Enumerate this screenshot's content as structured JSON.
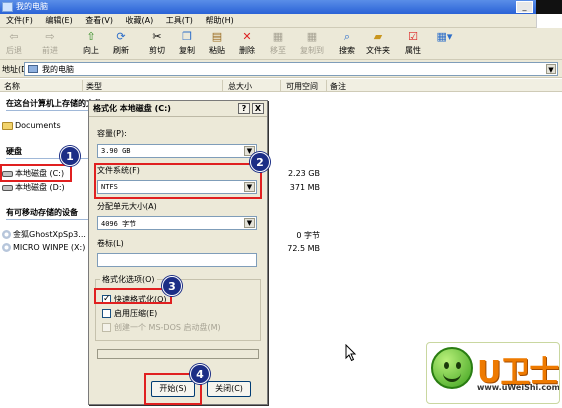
{
  "window": {
    "title": "我的电脑"
  },
  "menu": [
    "文件(F)",
    "编辑(E)",
    "查看(V)",
    "收藏(A)",
    "工具(T)",
    "帮助(H)"
  ],
  "toolbar": {
    "back": "后退",
    "forward": "前进",
    "up": "向上",
    "refresh": "刷新",
    "cut": "剪切",
    "copy": "复制",
    "paste": "粘贴",
    "delete": "删除",
    "move_to": "移至",
    "copy_to": "复制到",
    "search": "搜索",
    "folders": "文件夹",
    "properties": "属性"
  },
  "address": {
    "label": "地址(D)",
    "value": "我的电脑"
  },
  "columns": [
    "名称",
    "类型",
    "总大小",
    "可用空间",
    "备注"
  ],
  "groups": {
    "stored": "在这台计算机上存储的文件",
    "hdd": "硬盘",
    "removable": "有可移动存储的设备"
  },
  "items": {
    "documents": "Documents",
    "drive_c": "本地磁盘 (C:)",
    "drive_d": "本地磁盘 (D:)",
    "cd1": "金狐GhostXpSp3...",
    "cd2": "MICRO WINPE (X:)"
  },
  "sizes": {
    "c_free": "2.23 GB",
    "d_free": "371 MB",
    "cd1_free": "0 字节",
    "cd2_free": "72.5 MB"
  },
  "dialog": {
    "title": "格式化 本地磁盘 (C:)",
    "help": "?",
    "close": "X",
    "capacity_label": "容量(P):",
    "capacity_value": "3.90 GB",
    "fs_label": "文件系统(F)",
    "fs_value": "NTFS",
    "alloc_label": "分配单元大小(A)",
    "alloc_value": "4096 字节",
    "volume_label": "卷标(L)",
    "volume_value": "",
    "options_legend": "格式化选项(O)",
    "quick_format": "快速格式化(Q)",
    "quick_format_checked": true,
    "compress": "启用压缩(E)",
    "msdos": "创建一个 MS-DOS 启动盘(M)",
    "start": "开始(S)",
    "close_button": "关闭(C)"
  },
  "badges": [
    "1",
    "2",
    "3",
    "4"
  ],
  "logo": {
    "text": "U卫士",
    "url": "www.uWeiShi.com"
  }
}
